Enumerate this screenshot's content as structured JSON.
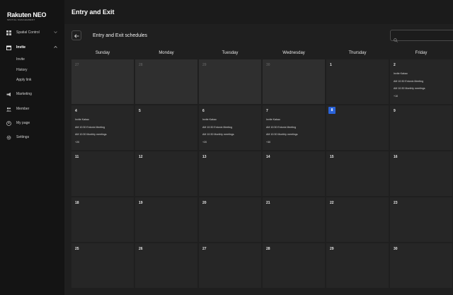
{
  "app": {
    "logo": "Rakuten NEO",
    "logo_sub": "SPATIAL MANAGEMENT"
  },
  "sidebar": {
    "items": [
      {
        "label": "Spatial Control",
        "icon": "grid-icon"
      },
      {
        "label": "Invite",
        "icon": "calendar-icon",
        "active": true
      },
      {
        "label": "Marketing",
        "icon": "megaphone-icon"
      },
      {
        "label": "Member",
        "icon": "people-icon"
      },
      {
        "label": "My page",
        "icon": "user-icon"
      },
      {
        "label": "Settings",
        "icon": "gear-icon"
      }
    ],
    "sub_items": [
      "Invite",
      "History",
      "Apply link"
    ]
  },
  "header": {
    "title": "Entry and Exit",
    "schedule_title": "Entry and Exit schedules",
    "search_placeholder": ""
  },
  "calendar": {
    "weekdays": [
      "Sunday",
      "Monday",
      "Tuesday",
      "Wednesday",
      "Thursday",
      "Friday"
    ],
    "weeks": [
      [
        {
          "day": "27",
          "other": true
        },
        {
          "day": "28",
          "other": true
        },
        {
          "day": "29",
          "other": true
        },
        {
          "day": "30",
          "other": true
        },
        {
          "day": "1"
        },
        {
          "day": "2",
          "events": [
            "Invite Kakao",
            "AM 10:30 Entonix Meeting",
            "AM 10:30 Monthly meetings",
            "+10"
          ]
        }
      ],
      [
        {
          "day": "4",
          "events": [
            "Invite Kakao",
            "AM 10:30 Entonix Meeting",
            "AM 10:30 Monthly meetings",
            "+20"
          ]
        },
        {
          "day": "5"
        },
        {
          "day": "6",
          "events": [
            "Invite Kakao",
            "AM 10:30 Entonix Meeting",
            "AM 10:30 Monthly meetings",
            "+20"
          ]
        },
        {
          "day": "7",
          "events": [
            "Invite Kakao",
            "AM 10:30 Entonix Meeting",
            "AM 10:30 Monthly meetings",
            "+30"
          ]
        },
        {
          "day": "8",
          "today": true
        },
        {
          "day": "9"
        }
      ],
      [
        {
          "day": "11"
        },
        {
          "day": "12"
        },
        {
          "day": "13"
        },
        {
          "day": "14"
        },
        {
          "day": "15"
        },
        {
          "day": "16"
        }
      ],
      [
        {
          "day": "18"
        },
        {
          "day": "19"
        },
        {
          "day": "20"
        },
        {
          "day": "21"
        },
        {
          "day": "22"
        },
        {
          "day": "23"
        }
      ],
      [
        {
          "day": "25"
        },
        {
          "day": "26"
        },
        {
          "day": "27"
        },
        {
          "day": "28"
        },
        {
          "day": "29"
        },
        {
          "day": "30"
        }
      ]
    ]
  },
  "colors": {
    "cell_normal": "#262626",
    "cell_other": "#2f2f2f",
    "today": "#2a63d9"
  }
}
